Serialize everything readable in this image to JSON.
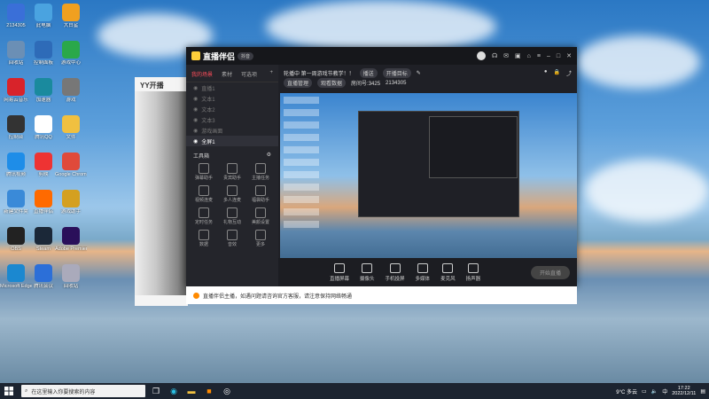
{
  "desktop": {
    "icons": [
      {
        "label": "2134305",
        "color": "#3a6fd8"
      },
      {
        "label": "此电脑",
        "color": "#4aa3e0"
      },
      {
        "label": "大白鲨",
        "color": "#f0a020"
      },
      {
        "label": "回收站",
        "color": "#6b8fb5"
      },
      {
        "label": "控制面板",
        "color": "#2e6bb8"
      },
      {
        "label": "游戏中心",
        "color": "#2aa84a"
      },
      {
        "label": "网易云音乐",
        "color": "#d8232a"
      },
      {
        "label": "加速器",
        "color": "#1a8a9e"
      },
      {
        "label": "游戏",
        "color": "#777"
      },
      {
        "label": "控制台",
        "color": "#333"
      },
      {
        "label": "腾讯QQ",
        "color": "#ffffff"
      },
      {
        "label": "文件",
        "color": "#f0c040"
      },
      {
        "label": "腾讯视频",
        "color": "#1e8de8"
      },
      {
        "label": "剪映",
        "color": "#e33"
      },
      {
        "label": "Google Chrome",
        "color": "#e04a3a"
      },
      {
        "label": "新建文件夹",
        "color": "#3a8ad8"
      },
      {
        "label": "直播伴侣",
        "color": "#ff6a00"
      },
      {
        "label": "游戏助手",
        "color": "#d4a020"
      },
      {
        "label": "OBS",
        "color": "#222"
      },
      {
        "label": "Steam",
        "color": "#1b2838"
      },
      {
        "label": "Adobe Premiere",
        "color": "#2a0f5a"
      },
      {
        "label": "Microsoft Edge",
        "color": "#1b88d0"
      },
      {
        "label": "腾讯会议",
        "color": "#2c6fd8"
      },
      {
        "label": "回收站",
        "color": "#aab"
      }
    ]
  },
  "yy": {
    "title": "YY开播"
  },
  "app": {
    "title": "直播伴侣",
    "badge": "抖音",
    "sidebar_tabs": [
      "我的场景",
      "素材",
      "可选项"
    ],
    "scenes": [
      "直播1",
      "文本1",
      "文本2",
      "文本3",
      "游戏画面",
      "全屏1"
    ],
    "tool_header": "工具箱",
    "tools": [
      "弹幕助手",
      "贵宾助手",
      "主播任务",
      "视频连麦",
      "多人连麦",
      "福袋助手",
      "定时任务",
      "礼物互动",
      "美颜设置",
      "数据",
      "音效",
      "更多"
    ],
    "live_title": "轮播中 第一周游戏节教学！！",
    "tag_a": "播送",
    "tag_b": "开播目标",
    "meta_a": "直播管理",
    "meta_b": "观看数据",
    "meta_c": "房间号:3425",
    "meta_d": "2134305",
    "bottom": [
      "直播屏幕",
      "摄像头",
      "手机投屏",
      "多媒体",
      "麦克风",
      "扬声器"
    ],
    "go_live": "开始直播",
    "notice": "直播伴侣主播，如遇问题请咨询官方客服，请注意保持网络畅通"
  },
  "taskbar": {
    "search_placeholder": "在这里输入你要搜索的内容",
    "weather": "9°C 多云",
    "time": "17:22",
    "date": "2022/12/11"
  }
}
